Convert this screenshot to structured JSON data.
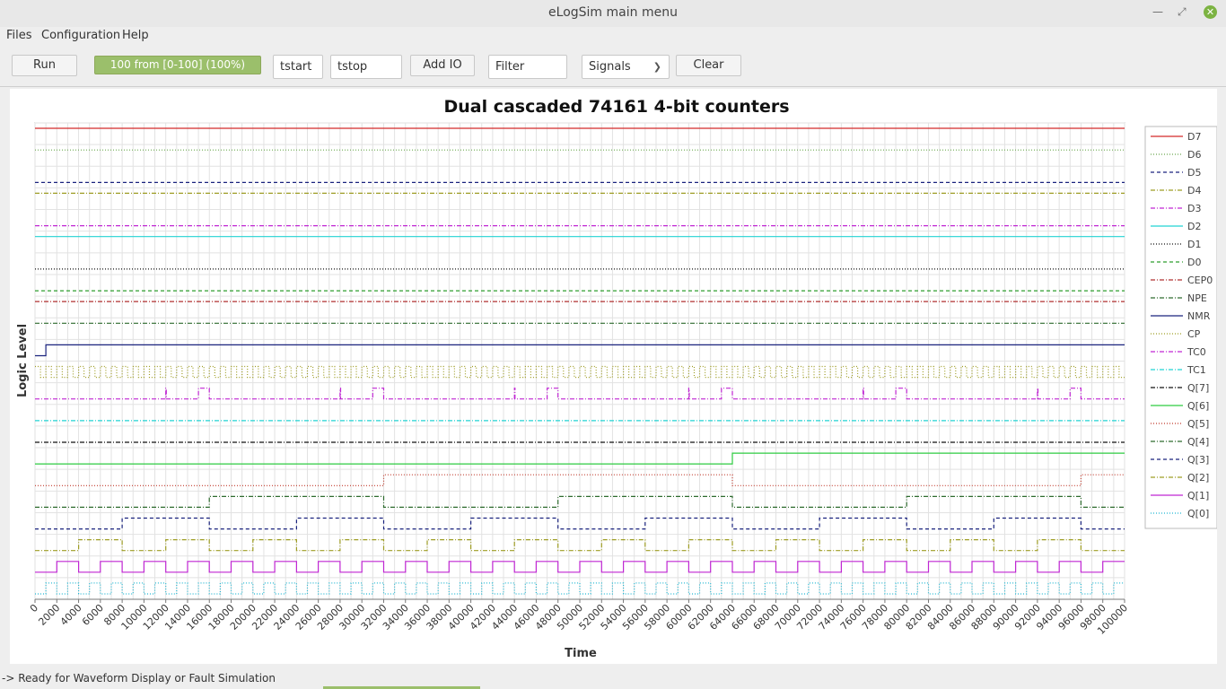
{
  "window": {
    "title": "eLogSim main menu",
    "min_icon": "minimize-icon",
    "max_icon": "maximize-icon",
    "close_icon": "close-icon"
  },
  "menu": {
    "items": [
      "Files",
      "Configuration",
      "Help"
    ]
  },
  "toolbar": {
    "run_label": "Run",
    "progress_label": "100 from [0-100] (100%)",
    "progress_fraction": 1.0,
    "tstart_value": "tstart",
    "tstop_value": "tstop",
    "addio_label": "Add IO",
    "filter_placeholder": "Filter",
    "signals_selected": "Signals",
    "clear_label": "Clear"
  },
  "status": {
    "text": "-> Ready for Waveform Display or Fault Simulation"
  },
  "chart_data": {
    "type": "line",
    "title": "Dual cascaded 74161 4-bit counters",
    "xlabel": "Time",
    "ylabel": "Logic Level",
    "xlim": [
      0,
      100000
    ],
    "x_ticks": [
      0,
      2000,
      4000,
      6000,
      8000,
      10000,
      12000,
      14000,
      16000,
      18000,
      20000,
      22000,
      24000,
      26000,
      28000,
      30000,
      32000,
      34000,
      36000,
      38000,
      40000,
      42000,
      44000,
      46000,
      48000,
      50000,
      52000,
      54000,
      56000,
      58000,
      60000,
      62000,
      64000,
      66000,
      68000,
      70000,
      72000,
      74000,
      76000,
      78000,
      80000,
      82000,
      84000,
      86000,
      88000,
      90000,
      92000,
      94000,
      96000,
      98000,
      100000
    ],
    "grid": true,
    "legend_position": "right",
    "series": [
      {
        "name": "D7",
        "color": "#d42b2b",
        "dash": "solid",
        "kind": "const",
        "value": 1
      },
      {
        "name": "D6",
        "color": "#6aa84f",
        "dash": "dot",
        "kind": "const",
        "value": 1
      },
      {
        "name": "D5",
        "color": "#1a237e",
        "dash": "dash",
        "kind": "const",
        "value": 0
      },
      {
        "name": "D4",
        "color": "#9e9d24",
        "dash": "dashdot",
        "kind": "const",
        "value": 1
      },
      {
        "name": "D3",
        "color": "#c026d3",
        "dash": "dashdot",
        "kind": "const",
        "value": 0
      },
      {
        "name": "D2",
        "color": "#22d3d3",
        "dash": "solid",
        "kind": "const",
        "value": 1
      },
      {
        "name": "D1",
        "color": "#111111",
        "dash": "dot",
        "kind": "const",
        "value": 0
      },
      {
        "name": "D0",
        "color": "#2e9e2e",
        "dash": "dash",
        "kind": "const",
        "value": 0
      },
      {
        "name": "CEP0",
        "color": "#b03030",
        "dash": "dashdot",
        "kind": "const",
        "value": 1
      },
      {
        "name": "NPE",
        "color": "#2e6b2e",
        "dash": "dashdot",
        "kind": "const",
        "value": 1
      },
      {
        "name": "NMR",
        "color": "#1a237e",
        "dash": "solid",
        "kind": "edges",
        "initial": 0,
        "edges": [
          1000
        ]
      },
      {
        "name": "CP",
        "color": "#9e9d24",
        "dash": "dot",
        "kind": "clock",
        "initial": 1,
        "period": 1000
      },
      {
        "name": "TC0",
        "color": "#c026d3",
        "dash": "dashdot",
        "kind": "pulses",
        "initial": 0,
        "pulses": [
          [
            12000,
            12050
          ],
          [
            15000,
            16000
          ],
          [
            28000,
            28050
          ],
          [
            31000,
            32000
          ],
          [
            44000,
            44050
          ],
          [
            47000,
            48000
          ],
          [
            60000,
            60050
          ],
          [
            63000,
            64000
          ],
          [
            76000,
            76050
          ],
          [
            79000,
            80000
          ],
          [
            92000,
            92050
          ],
          [
            95000,
            96000
          ]
        ]
      },
      {
        "name": "TC1",
        "color": "#22d3d3",
        "dash": "dashdot",
        "kind": "const",
        "value": 0
      },
      {
        "name": "Q[7]",
        "color": "#111111",
        "dash": "dashdot",
        "kind": "const",
        "value": 0
      },
      {
        "name": "Q[6]",
        "color": "#2ecc40",
        "dash": "solid",
        "kind": "edges",
        "initial": 0,
        "edges": [
          64000
        ]
      },
      {
        "name": "Q[5]",
        "color": "#c0392b",
        "dash": "dot",
        "kind": "edges",
        "initial": 0,
        "edges": [
          32000,
          64000,
          96000
        ]
      },
      {
        "name": "Q[4]",
        "color": "#2e6b2e",
        "dash": "dashdot",
        "kind": "square",
        "initial": 0,
        "half": 16000
      },
      {
        "name": "Q[3]",
        "color": "#1a237e",
        "dash": "dash",
        "kind": "square",
        "initial": 0,
        "half": 8000
      },
      {
        "name": "Q[2]",
        "color": "#9e9d24",
        "dash": "dashdot",
        "kind": "square",
        "initial": 0,
        "half": 4000
      },
      {
        "name": "Q[1]",
        "color": "#c026d3",
        "dash": "solid",
        "kind": "square",
        "initial": 0,
        "half": 2000
      },
      {
        "name": "Q[0]",
        "color": "#22b8d3",
        "dash": "dot",
        "kind": "square",
        "initial": 0,
        "half": 1000
      }
    ]
  }
}
